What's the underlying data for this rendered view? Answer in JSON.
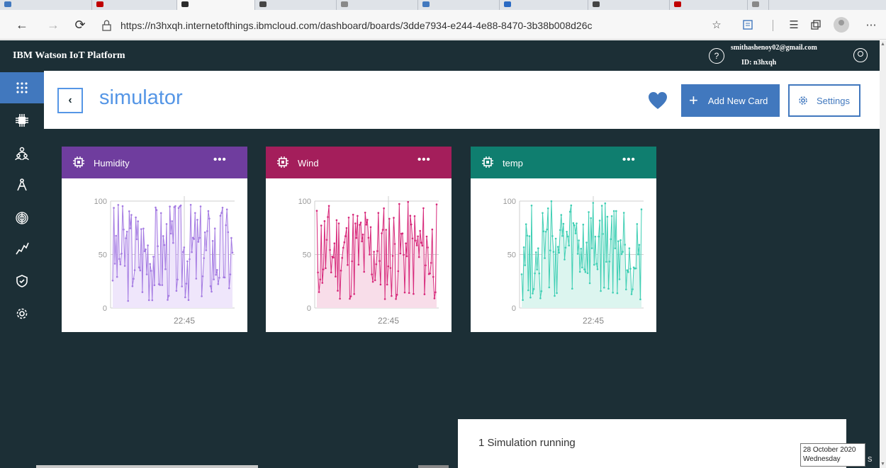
{
  "browser": {
    "tabs": [
      {
        "x": 0,
        "w": 130,
        "color": "#4178be"
      },
      {
        "x": 130,
        "w": 120,
        "color": "#c00000"
      },
      {
        "x": 250,
        "w": 110,
        "color": "#2b2b2b",
        "active": true
      },
      {
        "x": 360,
        "w": 115,
        "color": "#444444"
      },
      {
        "x": 475,
        "w": 115,
        "color": "#888888"
      },
      {
        "x": 590,
        "w": 115,
        "color": "#4178be"
      },
      {
        "x": 705,
        "w": 125,
        "color": "#2a6ac3"
      },
      {
        "x": 830,
        "w": 115,
        "color": "#444444"
      },
      {
        "x": 945,
        "w": 110,
        "color": "#c00000"
      },
      {
        "x": 1055,
        "w": 30,
        "color": "#888888"
      }
    ],
    "url": "https://n3hxqh.internetofthings.ibmcloud.com/dashboard/boards/3dde7934-e244-4e88-8470-3b38b008d26c"
  },
  "header": {
    "brand": "IBM Watson IoT Platform",
    "user_email": "smithashenoy02@gmail.com",
    "user_id": "ID: n3hxqh"
  },
  "board": {
    "title": "simulator",
    "add_card_label": "Add New Card",
    "settings_label": "Settings"
  },
  "cards": [
    {
      "name": "Humidity",
      "header_color": "#6f3d9e",
      "stroke": "#a47ae2",
      "fill": "#efe6fb",
      "seed": 3
    },
    {
      "name": "Wind",
      "header_color": "#a41e5b",
      "stroke": "#d7287a",
      "fill": "#f8dde9",
      "seed": 11
    },
    {
      "name": "temp",
      "header_color": "#0f7e6f",
      "stroke": "#3fcfb4",
      "fill": "#dcf5ef",
      "seed": 27
    }
  ],
  "chart_data": [
    {
      "type": "line",
      "title": "Humidity",
      "ylim": [
        0,
        100
      ],
      "yticks": [
        "100",
        "50",
        "0"
      ],
      "xticks": [
        "22:45"
      ]
    },
    {
      "type": "line",
      "title": "Wind",
      "ylim": [
        0,
        100
      ],
      "yticks": [
        "100",
        "50",
        "0"
      ],
      "xticks": [
        "22:45"
      ]
    },
    {
      "type": "line",
      "title": "temp",
      "ylim": [
        0,
        100
      ],
      "yticks": [
        "100",
        "50",
        "0"
      ],
      "xticks": [
        "22:45"
      ]
    }
  ],
  "toast": {
    "text": "1 Simulation running"
  },
  "tooltip": {
    "date": "28 October 2020",
    "day": "Wednesday",
    "trailing": "s"
  }
}
